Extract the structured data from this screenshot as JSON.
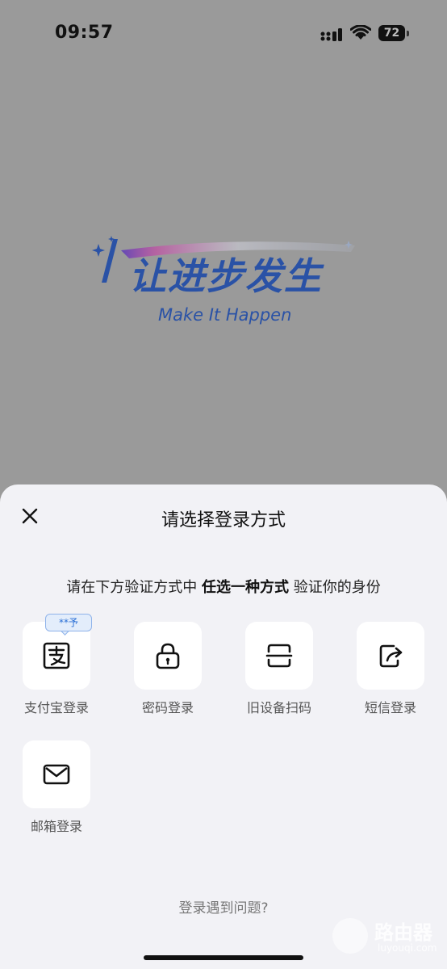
{
  "status_bar": {
    "time": "09:57",
    "battery": "72",
    "icons": [
      "cellular-signal-icon",
      "wifi-icon",
      "battery-icon"
    ]
  },
  "brand": {
    "slogan": "让进步发生",
    "slogan_en": "Make It Happen",
    "color": "#2a52a6"
  },
  "sheet": {
    "title": "请选择登录方式",
    "instruction": {
      "prefix": "请在下方验证方式中 ",
      "emphasis": "任选一种方式",
      "suffix": " 验证你的身份"
    },
    "options": [
      {
        "label": "支付宝登录",
        "icon": "alipay-icon",
        "badge": "**予"
      },
      {
        "label": "密码登录",
        "icon": "lock-icon"
      },
      {
        "label": "旧设备扫码",
        "icon": "scan-icon"
      },
      {
        "label": "短信登录",
        "icon": "share-sms-icon"
      },
      {
        "label": "邮箱登录",
        "icon": "mail-icon"
      }
    ],
    "help_link": "登录遇到问题?",
    "accent_color": "#2a6fd6"
  },
  "watermark": {
    "text": "路由器",
    "sub": "luyouqi.com"
  }
}
